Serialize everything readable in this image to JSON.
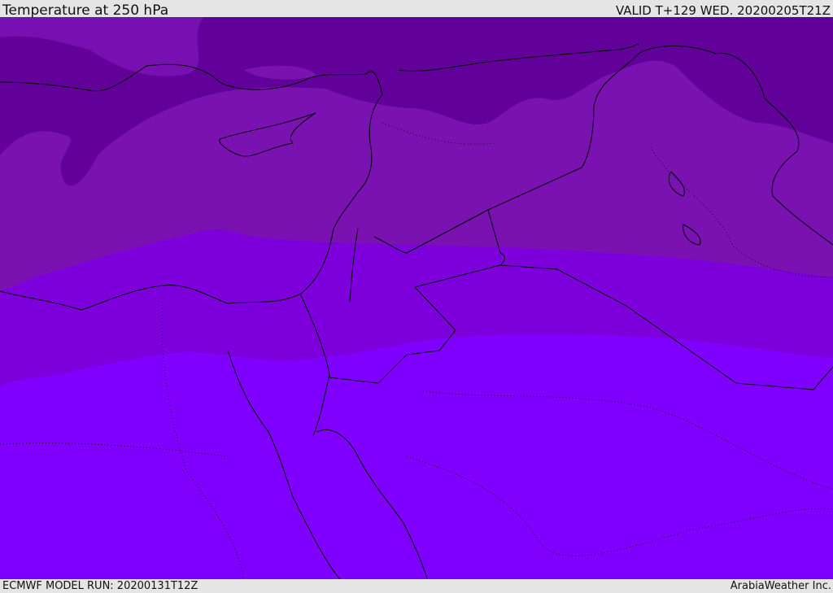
{
  "header": {
    "title": "Temperature at 250 hPa",
    "valid": "VALID T+129 WED. 20200205T21Z"
  },
  "footer": {
    "model_run": "ECMWF MODEL RUN: 20200131T12Z",
    "credit": "ArabiaWeather Inc."
  },
  "colors": {
    "band_coldest": "#62009a",
    "band_cold": "#7a12b2",
    "band_mid": "#7d00dc",
    "band_warm": "#7f00ff",
    "coastline": "#000000"
  }
}
